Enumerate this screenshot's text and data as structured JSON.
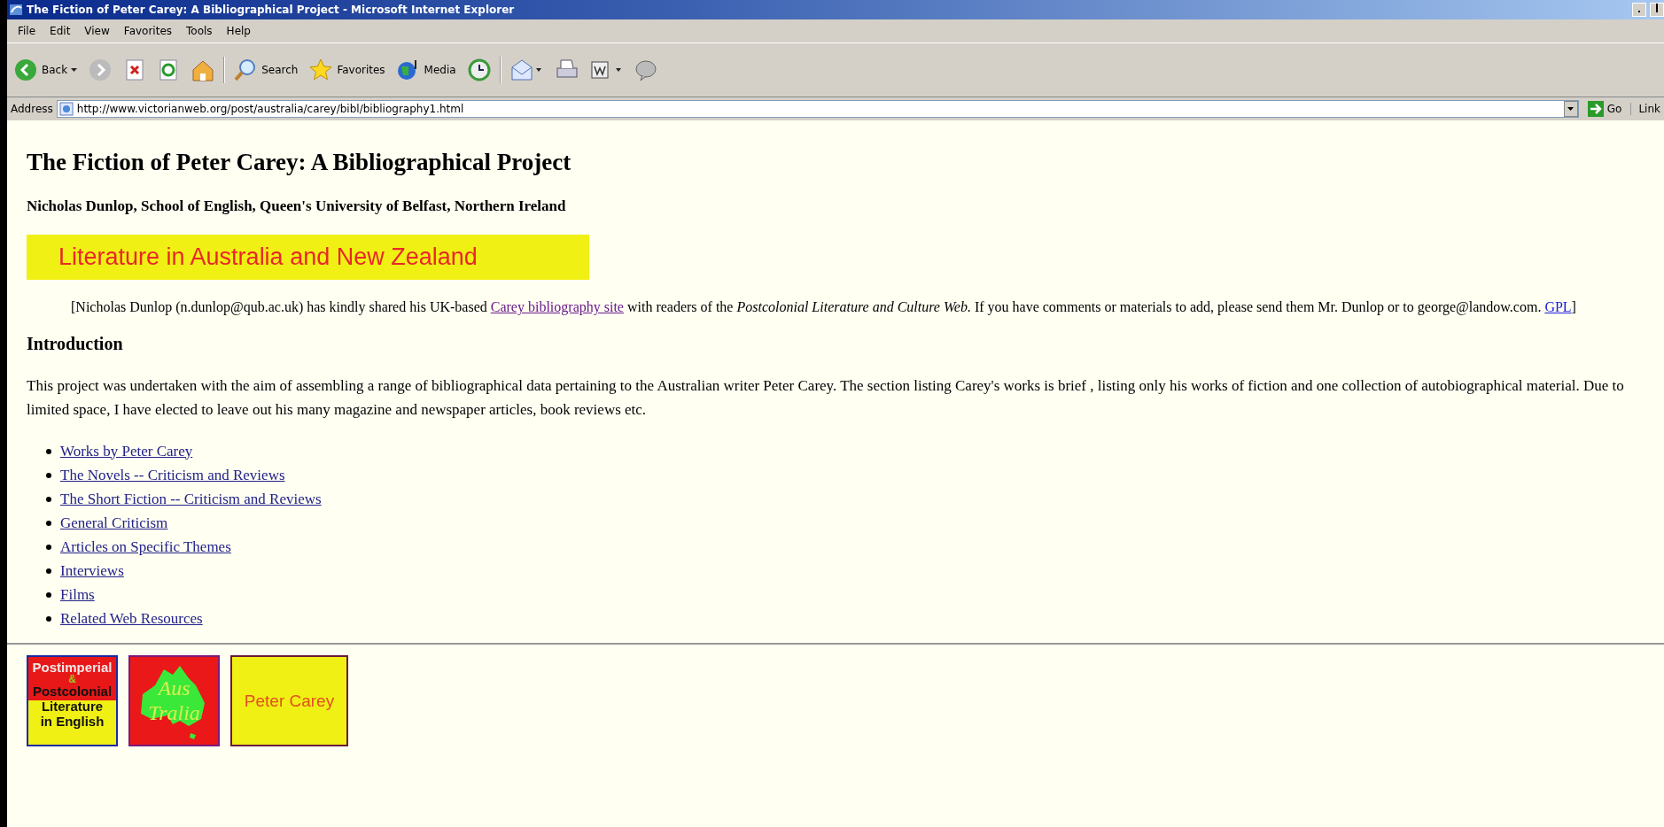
{
  "window": {
    "title": "The Fiction of Peter Carey: A Bibliographical Project - Microsoft Internet Explorer"
  },
  "menu": [
    "File",
    "Edit",
    "View",
    "Favorites",
    "Tools",
    "Help"
  ],
  "toolbar": [
    {
      "kind": "back",
      "label": "Back"
    },
    {
      "kind": "forward"
    },
    {
      "kind": "stop"
    },
    {
      "kind": "refresh"
    },
    {
      "kind": "home"
    },
    {
      "kind": "search",
      "label": "Search"
    },
    {
      "kind": "favorites",
      "label": "Favorites"
    },
    {
      "kind": "media",
      "label": "Media"
    },
    {
      "kind": "history"
    },
    {
      "kind": "mail"
    },
    {
      "kind": "print"
    },
    {
      "kind": "edit"
    },
    {
      "kind": "discuss"
    }
  ],
  "address_bar": {
    "label": "Address",
    "value": "http://www.victorianweb.org/post/australia/carey/bibl/bibliography1.html",
    "go": "Go",
    "links": "Link"
  },
  "page": {
    "title": "The Fiction of Peter Carey: A Bibliographical Project",
    "byline": "Nicholas Dunlop, School of English, Queen's University of Belfast, Northern Ireland",
    "banner": "Literature in Australia and New Zealand",
    "note": [
      {
        "kind": "text",
        "text": "[Nicholas Dunlop (n.dunlop@qub.ac.uk) has kindly shared his UK-based "
      },
      {
        "kind": "link",
        "text": "Carey bibliography site",
        "visited": true
      },
      {
        "kind": "text",
        "text": " with readers of the "
      },
      {
        "kind": "italic",
        "text": "Postcolonial Literature and Culture Web."
      },
      {
        "kind": "text",
        "text": " If you have comments or materials to add, please send them Mr. Dunlop or to george@landow.com. "
      },
      {
        "kind": "link",
        "text": "GPL",
        "visited": false
      },
      {
        "kind": "text",
        "text": "]"
      }
    ],
    "heading": "Introduction",
    "intro": "This project was undertaken with the aim of assembling a range of bibliographical data pertaining to the Australian writer Peter Carey. The section listing Carey's works is brief , listing only his works of fiction and one collection of autobiographical material. Due to limited space, I have elected to leave out his many magazine and newspaper articles, book reviews etc.",
    "links": [
      "Works by Peter Carey",
      "The Novels -- Criticism and Reviews",
      "The Short Fiction -- Criticism and Reviews",
      "General Criticism",
      "Articles on Specific Themes",
      "Interviews",
      "Films",
      "Related Web Resources"
    ],
    "logos": [
      {
        "kind": "postcolonial",
        "lines": [
          "Postimperial",
          "&",
          "Postcolonial",
          "Literature",
          "in English"
        ]
      },
      {
        "kind": "australia",
        "lines": [
          "Aus",
          "Tralia"
        ]
      },
      {
        "kind": "author",
        "lines": [
          "Peter Carey"
        ]
      }
    ]
  }
}
